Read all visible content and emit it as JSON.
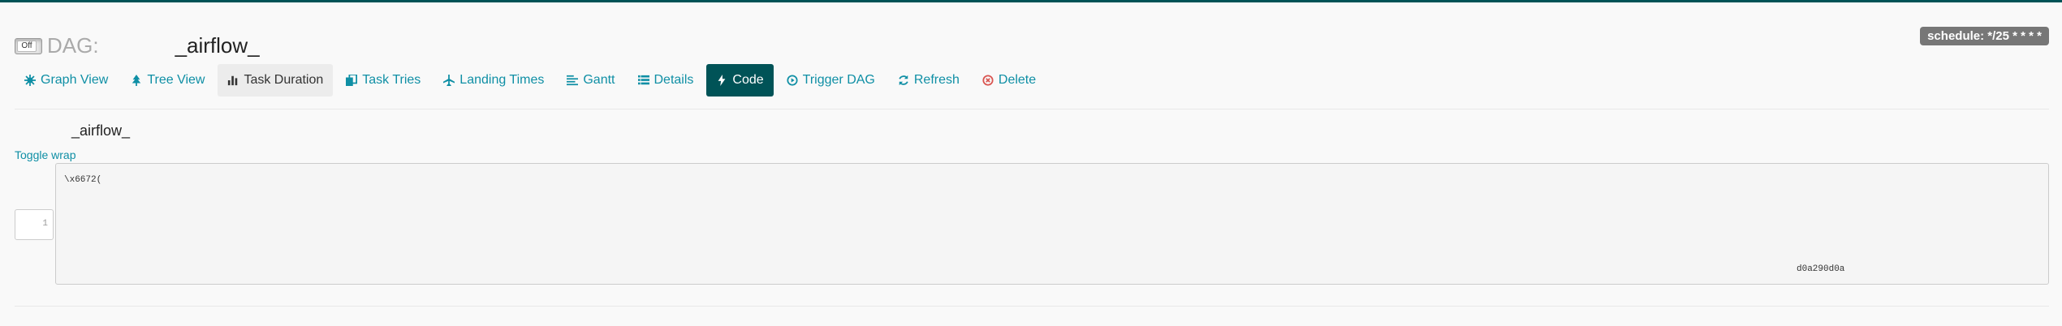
{
  "header": {
    "toggle_label": "Off",
    "dag_label": "DAG:",
    "dag_id": "_airflow_",
    "schedule": "schedule: */25 * * * *"
  },
  "nav": {
    "items": [
      {
        "label": "Graph View",
        "icon": "asterisk-icon"
      },
      {
        "label": "Tree View",
        "icon": "tree-icon"
      },
      {
        "label": "Task Duration",
        "icon": "bar-chart-icon"
      },
      {
        "label": "Task Tries",
        "icon": "duplicate-icon"
      },
      {
        "label": "Landing Times",
        "icon": "plane-icon"
      },
      {
        "label": "Gantt",
        "icon": "align-left-icon"
      },
      {
        "label": "Details",
        "icon": "list-icon"
      },
      {
        "label": "Code",
        "icon": "flash-icon"
      },
      {
        "label": "Trigger DAG",
        "icon": "play-circle-icon"
      },
      {
        "label": "Refresh",
        "icon": "refresh-icon"
      },
      {
        "label": "Delete",
        "icon": "remove-circle-icon"
      }
    ],
    "active": "Code",
    "hover": "Task Duration"
  },
  "code": {
    "title": "_airflow_",
    "toggle_wrap": "Toggle wrap",
    "line_number": "1",
    "text_start": "\\x6672(",
    "text_end": "d0a290d0a"
  },
  "colors": {
    "accent": "#005357",
    "link": "#0f8fa5",
    "danger": "#d9534f"
  }
}
